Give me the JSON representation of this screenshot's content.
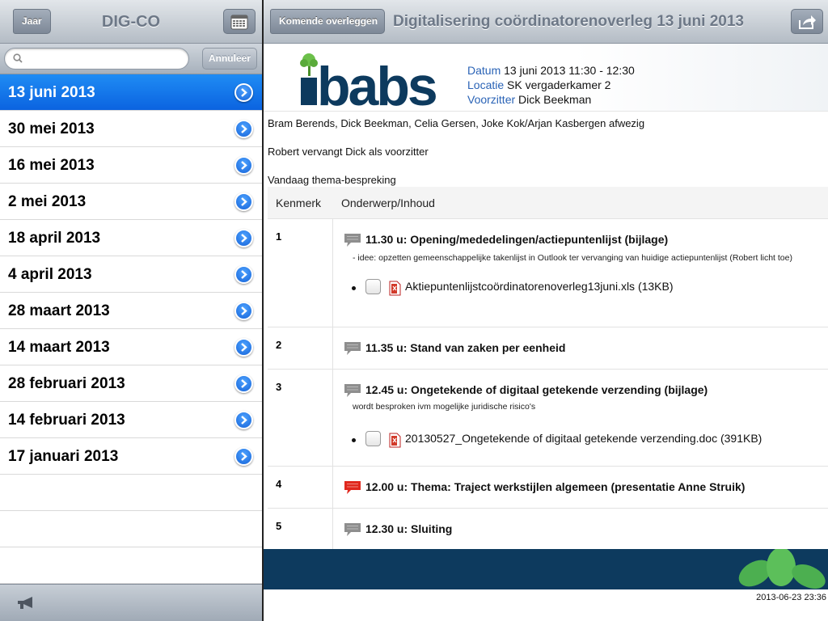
{
  "left": {
    "back_label": "Jaar",
    "title": "DIG-CO",
    "search": {
      "value": "",
      "placeholder": ""
    },
    "cancel_label": "Annuleer",
    "items": [
      {
        "label": "13 juni 2013",
        "selected": true
      },
      {
        "label": "30 mei 2013"
      },
      {
        "label": "16 mei 2013"
      },
      {
        "label": "2 mei 2013"
      },
      {
        "label": "18 april 2013"
      },
      {
        "label": "4 april 2013"
      },
      {
        "label": "28 maart 2013"
      },
      {
        "label": "14 maart 2013"
      },
      {
        "label": "28 februari 2013"
      },
      {
        "label": "14 februari 2013"
      },
      {
        "label": "17 januari 2013"
      }
    ]
  },
  "right": {
    "back_label": "Komende overleggen",
    "title": "Digitalisering coördinatorenoverleg 13 juni 2013",
    "logo_text": "ibabs",
    "meta": {
      "datum_key": "Datum",
      "datum_val": "13 juni 2013 11:30 - 12:30",
      "locatie_key": "Locatie",
      "locatie_val": "SK vergaderkamer 2",
      "voorzitter_key": "Voorzitter",
      "voorzitter_val": "Dick Beekman"
    },
    "intro": [
      "Bram Berends, Dick Beekman, Celia Gersen, Joke Kok/Arjan Kasbergen afwezig",
      "Robert vervangt Dick als voorzitter",
      "Vandaag thema-bespreking"
    ],
    "table_headers": {
      "kenmerk": "Kenmerk",
      "onderwerp": "Onderwerp/Inhoud"
    },
    "agenda": [
      {
        "num": "1",
        "title": "11.30 u: Opening/mededelingen/actiepuntenlijst (bijlage)",
        "note": "- idee: opzetten gemeenschappelijke takenlijst in Outlook ter vervanging van huidige actiepuntenlijst (Robert licht toe)",
        "attachment": "Aktiepuntenlijstcoördinatorenoverleg13juni.xls (13KB)"
      },
      {
        "num": "2",
        "title": "11.35 u: Stand van zaken per eenheid"
      },
      {
        "num": "3",
        "title": "12.45 u: Ongetekende of digitaal getekende verzending (bijlage)",
        "note": "wordt besproken ivm mogelijke juridische risico's",
        "attachment": "20130527_Ongetekende of digitaal getekende verzending.doc (391KB)"
      },
      {
        "num": "4",
        "title": "12.00 u: Thema: Traject werkstijlen algemeen (presentatie Anne Struik)",
        "highlight": true
      },
      {
        "num": "5",
        "title": "12.30 u: Sluiting"
      }
    ],
    "timestamp": "2013-06-23 23:36"
  },
  "colors": {
    "selected_row": "#0b63e0",
    "meta_key": "#2a63b6",
    "footer_band": "#0d3a5e",
    "logo_dark": "#0d3a5e",
    "leaf_green": "#4caf50",
    "comment_red": "#e0281e",
    "comment_gray": "#8e8e8e"
  },
  "icons": [
    "calendar-icon",
    "search-icon",
    "chevron-right-icon",
    "megaphone-icon",
    "share-icon",
    "comment-icon",
    "document-icon",
    "tree-logo-icon",
    "leaf-icon"
  ]
}
